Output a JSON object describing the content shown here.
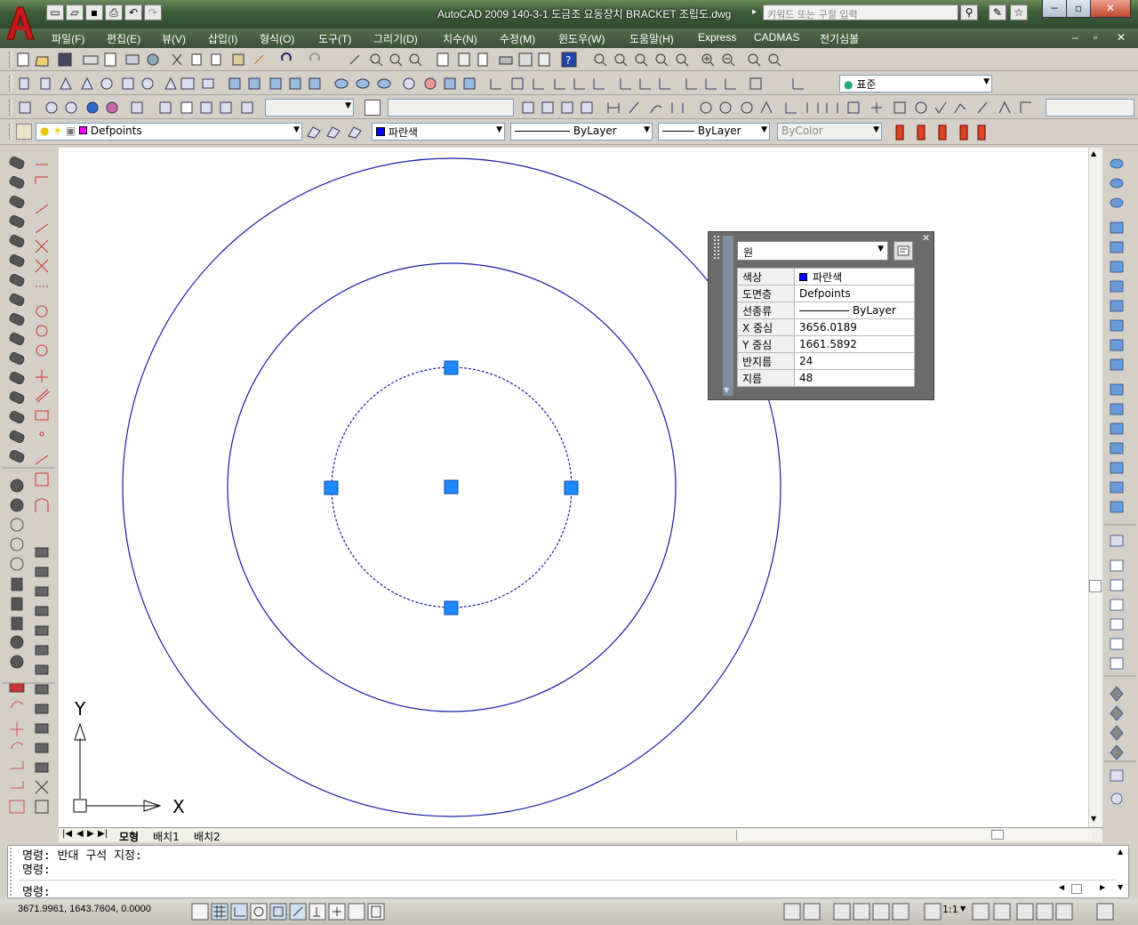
{
  "window": {
    "title": "AutoCAD 2009 140-3-1 도금조 요동장치 BRACKET 조립도.dwg",
    "search_placeholder": "키워드 또는 구절 입력",
    "minimize": "−",
    "restore": "▫",
    "close": "✕"
  },
  "menu": [
    "파일(F)",
    "편집(E)",
    "뷰(V)",
    "삽입(I)",
    "형식(O)",
    "도구(T)",
    "그리기(D)",
    "치수(N)",
    "수정(M)",
    "윈도우(W)",
    "도움말(H)",
    "Express",
    "CADMAS",
    "전기심볼"
  ],
  "toolbar": {
    "text_style": "표준",
    "layer": "Defpoints",
    "color": "파란색",
    "linetype": "ByLayer",
    "lineweight": "ByLayer",
    "plotstyle": "ByColor"
  },
  "quick_properties": {
    "object_type": "원",
    "rows": [
      {
        "key": "색상",
        "value": "파란색"
      },
      {
        "key": "도면층",
        "value": "Defpoints"
      },
      {
        "key": "선종류",
        "value": "ByLayer"
      },
      {
        "key": "X 중심",
        "value": "3656.0189"
      },
      {
        "key": "Y 중심",
        "value": "1661.5892"
      },
      {
        "key": "반지름",
        "value": "24"
      },
      {
        "key": "지름",
        "value": "48"
      }
    ],
    "close": "✕"
  },
  "ucs": {
    "x_label": "X",
    "y_label": "Y"
  },
  "layout_tabs": [
    "모형",
    "배치1",
    "배치2"
  ],
  "command": {
    "lines": [
      "명령: 반대 구석 지정:",
      "명령:"
    ],
    "prompt": "명령:"
  },
  "status": {
    "coords": "3671.9961, 1643.7604, 0.0000",
    "scale": "1:1"
  },
  "colors": {
    "circle": "#1a1aa8",
    "grip": "#1e88ff",
    "blue_swatch": "#0000ff"
  }
}
